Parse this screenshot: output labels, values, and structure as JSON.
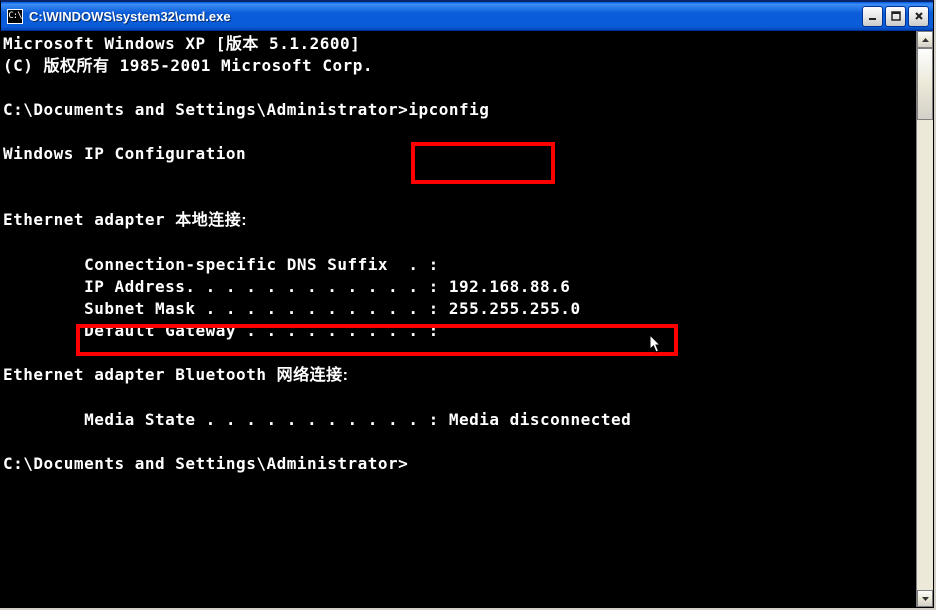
{
  "window": {
    "icon_text": "C:\\",
    "title": "C:\\WINDOWS\\system32\\cmd.exe"
  },
  "terminal": {
    "line1": "Microsoft Windows XP [版本 5.1.2600]",
    "line2": "(C) 版权所有 1985-2001 Microsoft Corp.",
    "line3": "",
    "prompt1a": "C:\\Documents and Settings\\Administrator>",
    "prompt1b": "ipconfig",
    "line5": "",
    "line6": "Windows IP Configuration",
    "line7": "",
    "line8": "",
    "eth_header_a": "Ethernet adapter ",
    "eth_header_b": "本地连接:",
    "line10": "",
    "line11": "        Connection-specific DNS Suffix  . :",
    "line12": "        IP Address. . . . . . . . . . . . : 192.168.88.6",
    "line13": "        Subnet Mask . . . . . . . . . . . : 255.255.255.0",
    "line14": "        Default Gateway . . . . . . . . . :",
    "line15": "",
    "bt_header_a": "Ethernet adapter Bluetooth ",
    "bt_header_b": "网络连接:",
    "line17": "",
    "line18": "        Media State . . . . . . . . . . . : Media disconnected",
    "line19": "",
    "prompt2": "C:\\Documents and Settings\\Administrator>"
  }
}
